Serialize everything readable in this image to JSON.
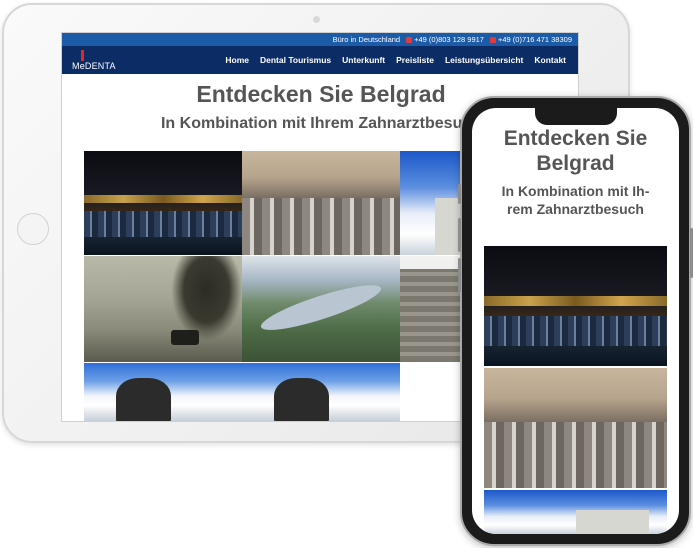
{
  "topbar": {
    "label": "Büro in Deutschland",
    "phone1": "+49 (0)803 128 9917",
    "phone2": "+49 (0)716 471 38309"
  },
  "brand": {
    "logo_text": "MeDENTA"
  },
  "nav": {
    "items": [
      "Home",
      "Dental Tourismus",
      "Unterkunft",
      "Preisliste",
      "Leistungsübersicht",
      "Kontakt"
    ]
  },
  "page": {
    "title": "Entdecken Sie Belgrad",
    "subtitle": "In Kombination mit Ihrem Zahnarztbesuch"
  },
  "phone": {
    "title_line1": "Entdecken Sie",
    "title_line2": "Belgrad",
    "subtitle_line1": "In Kombination mit Ih-",
    "subtitle_line2": "rem Zahnarztbesuch"
  },
  "colors": {
    "topbar": "#1c5ba8",
    "navbar": "#0c2c66",
    "heading": "#555555",
    "logo_accent": "#e32626"
  },
  "gallery_icons": [
    "night-city-photo",
    "city-aerial-photo",
    "sky-monument-photo",
    "park-bench-photo",
    "river-aerial-photo",
    "fortress-tower-photo",
    "statue-photo",
    "equestrian-statue-photo"
  ]
}
